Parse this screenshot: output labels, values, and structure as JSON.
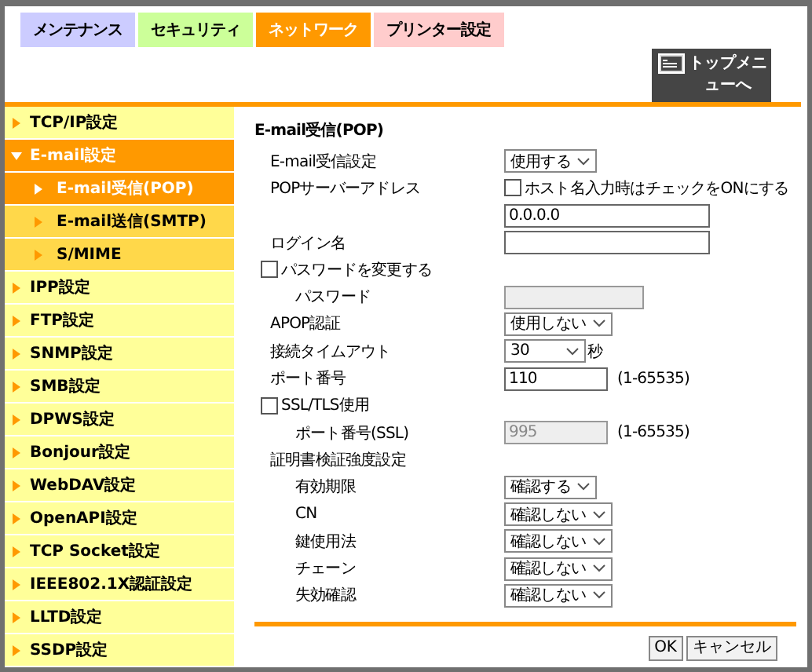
{
  "tabs": [
    {
      "label": "メンテナンス",
      "color": "#ccccff",
      "selected": false
    },
    {
      "label": "セキュリティ",
      "color": "#ccff99",
      "selected": false
    },
    {
      "label": "ネットワーク",
      "color": "#ff9900",
      "selected": true
    },
    {
      "label": "プリンター設定",
      "color": "#ffcccc",
      "selected": false
    }
  ],
  "top_menu_button": {
    "label": "トップメニューへ"
  },
  "sidebar": {
    "items": [
      {
        "label": "TCP/IP設定",
        "selected": false,
        "expanded": false
      },
      {
        "label": "E-mail設定",
        "selected": false,
        "expanded": true,
        "children": [
          {
            "label": "E-mail受信(POP)",
            "selected": true
          },
          {
            "label": "E-mail送信(SMTP)",
            "selected": false
          },
          {
            "label": "S/MIME",
            "selected": false
          }
        ]
      },
      {
        "label": "IPP設定",
        "selected": false,
        "expanded": false
      },
      {
        "label": "FTP設定",
        "selected": false,
        "expanded": false
      },
      {
        "label": "SNMP設定",
        "selected": false,
        "expanded": false
      },
      {
        "label": "SMB設定",
        "selected": false,
        "expanded": false
      },
      {
        "label": "DPWS設定",
        "selected": false,
        "expanded": false
      },
      {
        "label": "Bonjour設定",
        "selected": false,
        "expanded": false
      },
      {
        "label": "WebDAV設定",
        "selected": false,
        "expanded": false
      },
      {
        "label": "OpenAPI設定",
        "selected": false,
        "expanded": false
      },
      {
        "label": "TCP Socket設定",
        "selected": false,
        "expanded": false
      },
      {
        "label": "IEEE802.1X認証設定",
        "selected": false,
        "expanded": false
      },
      {
        "label": "LLTD設定",
        "selected": false,
        "expanded": false
      },
      {
        "label": "SSDP設定",
        "selected": false,
        "expanded": false
      }
    ]
  },
  "form": {
    "title": "E-mail受信(POP)",
    "rows": [
      {
        "kind": "select",
        "label": "E-mail受信設定",
        "value": "使用する"
      },
      {
        "kind": "option",
        "label": "POPサーバーアドレス",
        "option_label": "ホスト名入力時はチェックをONにする",
        "checked": false
      },
      {
        "kind": "text",
        "value": "0.0.0.0",
        "disabled": false
      },
      {
        "kind": "text",
        "label": "ログイン名",
        "disabled": false
      },
      {
        "kind": "checkbox",
        "label": "パスワードを変更する",
        "checked": false,
        "children": [
          {
            "kind": "password",
            "label": "パスワード",
            "disabled": true
          }
        ]
      },
      {
        "kind": "select",
        "label": "APOP認証",
        "value": "使用しない"
      },
      {
        "kind": "select",
        "label": "接続タイムアウト",
        "value": "30",
        "unit": "秒"
      },
      {
        "kind": "number",
        "label": "ポート番号",
        "value": "110",
        "range": "(1-65535)",
        "disabled": false
      },
      {
        "kind": "checkbox",
        "label": "SSL/TLS使用",
        "checked": false,
        "children": [
          {
            "kind": "number",
            "label": "ポート番号(SSL)",
            "value": "995",
            "range": "(1-65535)",
            "disabled": true
          }
        ]
      },
      {
        "kind": "heading",
        "label": "証明書検証強度設定",
        "children": [
          {
            "kind": "select",
            "label": "有効期限",
            "value": "確認する"
          },
          {
            "kind": "select",
            "label": "CN",
            "value": "確認しない"
          },
          {
            "kind": "select",
            "label": "鍵使用法",
            "value": "確認しない"
          },
          {
            "kind": "select",
            "label": "チェーン",
            "value": "確認しない"
          },
          {
            "kind": "select",
            "label": "失効確認",
            "value": "確認しない"
          }
        ]
      }
    ],
    "buttons": [
      {
        "label": "OK"
      },
      {
        "label": "キャンセル"
      }
    ]
  }
}
